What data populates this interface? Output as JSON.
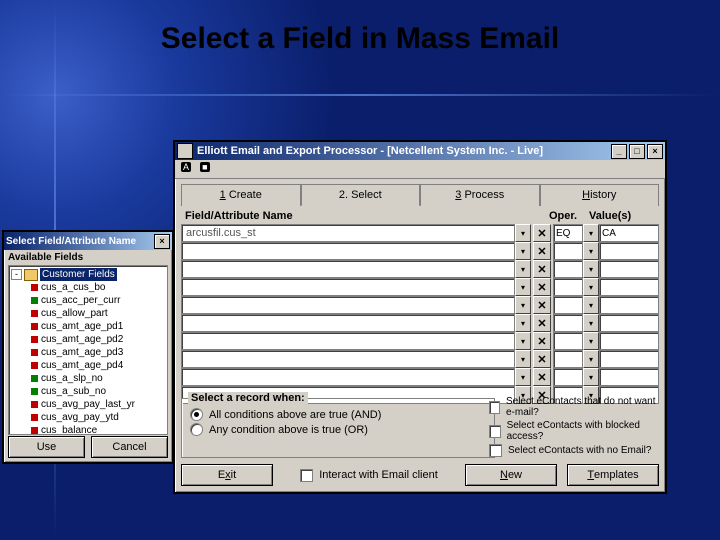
{
  "slide": {
    "title": "Select a Field in Mass Email"
  },
  "mainWin": {
    "title": "Elliott Email and Export Processor - [Netcellent System Inc. - Live]",
    "tabs": [
      {
        "num": "1",
        "label": "Create"
      },
      {
        "num": "2.",
        "label": "Select",
        "active": true
      },
      {
        "num": "3",
        "label": "Process"
      },
      {
        "label": "History"
      }
    ],
    "cols": {
      "field": "Field/Attribute Name",
      "oper": "Oper.",
      "vals": "Value(s)"
    },
    "rows": [
      {
        "field": "arcusfil.cus_st",
        "op": "EQ",
        "val": "CA"
      },
      {
        "field": "",
        "op": "",
        "val": ""
      },
      {
        "field": "",
        "op": "",
        "val": ""
      },
      {
        "field": "",
        "op": "",
        "val": ""
      },
      {
        "field": "",
        "op": "",
        "val": ""
      },
      {
        "field": "",
        "op": "",
        "val": ""
      },
      {
        "field": "",
        "op": "",
        "val": ""
      },
      {
        "field": "",
        "op": "",
        "val": ""
      },
      {
        "field": "",
        "op": "",
        "val": ""
      },
      {
        "field": "",
        "op": "",
        "val": ""
      }
    ],
    "group": {
      "label": "Select a record when:",
      "opt1": "All conditions above are true (AND)",
      "opt2": "Any condition above is true (OR)"
    },
    "checks": [
      "Select eContacts that do not want e-mail?",
      "Select eContacts with blocked access?",
      "Select eContacts with no Email?"
    ],
    "buttons": {
      "exit": "Exit",
      "interact": "Interact with Email client",
      "new": "New",
      "templates": "Templates"
    }
  },
  "popup": {
    "title": "Select Field/Attribute Name",
    "avail": "Available Fields",
    "root": "Customer Fields",
    "items": [
      "cus_a_cus_bo",
      "cus_acc_per_curr",
      "cus_allow_part",
      "cus_amt_age_pd1",
      "cus_amt_age_pd2",
      "cus_amt_age_pd3",
      "cus_amt_age_pd4",
      "cus_a_slp_no",
      "cus_a_sub_no",
      "cus_avg_pay_last_yr",
      "cus_avg_pay_ytd",
      "cus_balance"
    ],
    "use": "Use",
    "cancel": "Cancel"
  }
}
